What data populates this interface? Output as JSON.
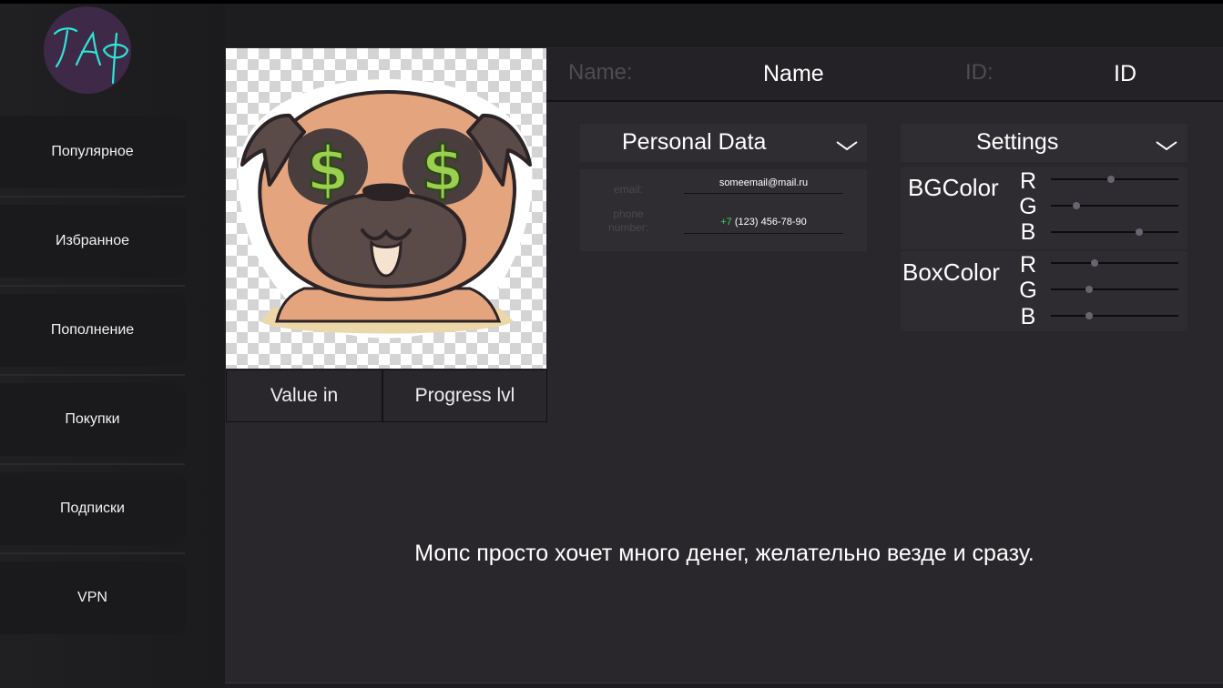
{
  "app": {
    "logo_text": "ГАР"
  },
  "sidebar": {
    "items": [
      {
        "label": "Популярное"
      },
      {
        "label": "Избранное"
      },
      {
        "label": "Пополнение"
      },
      {
        "label": "Покупки"
      },
      {
        "label": "Подписки"
      },
      {
        "label": "VPN"
      }
    ]
  },
  "profile": {
    "name_label": "Name:",
    "name_value": "Name",
    "id_label": "ID:",
    "id_value": "ID",
    "value_in": "Value in",
    "progress_lvl": "Progress lvl",
    "description": "Мопс просто хочет много денег, желательно везде и сразу."
  },
  "personal": {
    "title": "Personal Data",
    "email_label": "email:",
    "email_value": "someemail@mail.ru",
    "phone_label_1": "phone",
    "phone_label_2": "number:",
    "phone_code": "+7",
    "phone_value": "(123) 456-78-90"
  },
  "settings": {
    "title": "Settings",
    "bg_label": "BGColor",
    "box_label": "BoxColor",
    "ch_r": "R",
    "ch_g": "G",
    "ch_b": "B",
    "bg_r_level": 0.47,
    "bg_g_level": 0.2,
    "bg_b_level": 0.69,
    "box_r_level": 0.34,
    "box_g_level": 0.3,
    "box_b_level": 0.3
  },
  "colors": {
    "accent": "#2ee6d6",
    "phone_code": "#3cd05a",
    "logo_bg": "#3e2a48"
  }
}
